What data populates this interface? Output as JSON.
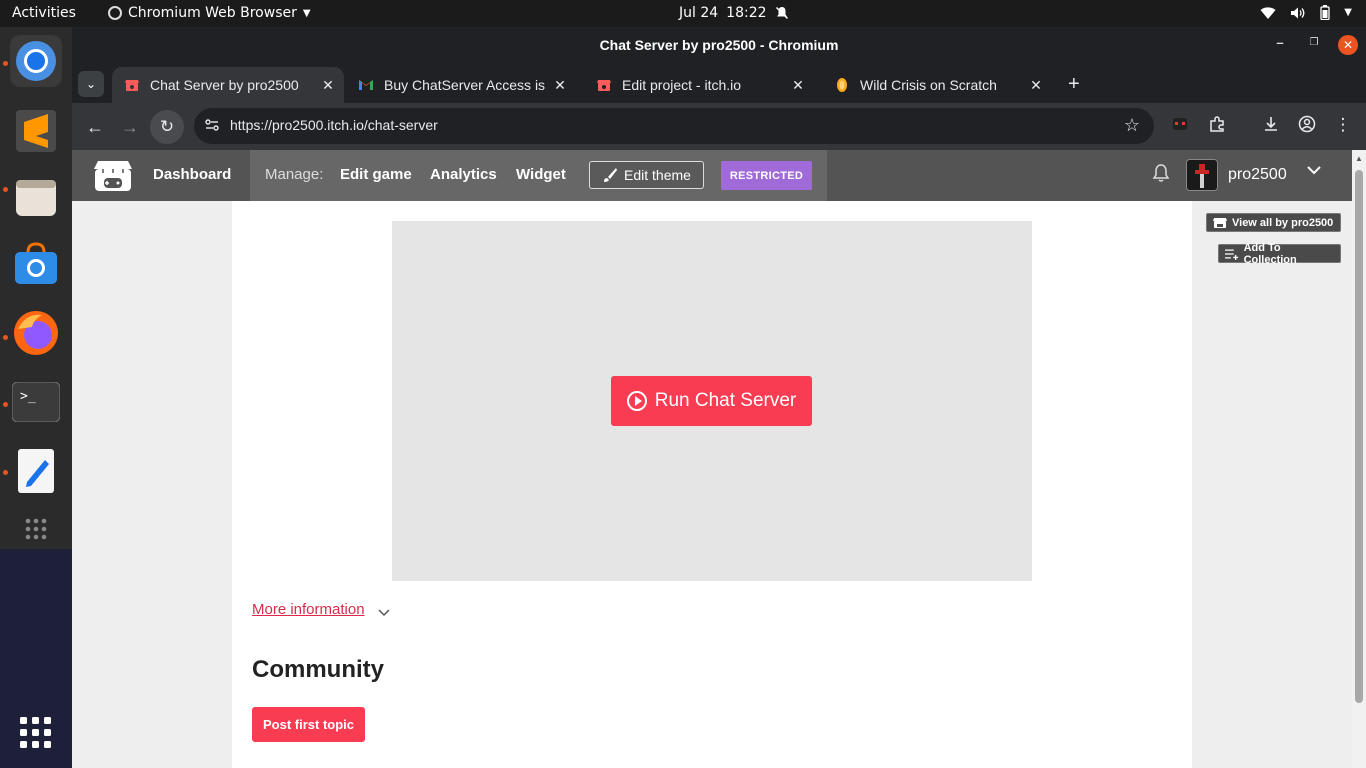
{
  "topbar": {
    "activities": "Activities",
    "app_name": "Chromium Web Browser",
    "date": "Jul 24",
    "time": "18:22"
  },
  "window": {
    "title": "Chat Server by pro2500 - Chromium"
  },
  "tabs": [
    {
      "label": "Chat Server by pro2500",
      "icon": "itchio-icon",
      "active": true
    },
    {
      "label": "Buy ChatServer Access is",
      "icon": "gmail-icon",
      "active": false
    },
    {
      "label": "Edit project - itch.io",
      "icon": "itchio-icon",
      "active": false
    },
    {
      "label": "Wild Crisis on Scratch",
      "icon": "scratch-icon",
      "active": false
    }
  ],
  "toolbar": {
    "url": "https://pro2500.itch.io/chat-server"
  },
  "itch_nav": {
    "dashboard": "Dashboard",
    "manage": "Manage:",
    "edit_game": "Edit game",
    "analytics": "Analytics",
    "widget": "Widget",
    "edit_theme": "Edit theme",
    "restricted": "RESTRICTED",
    "username": "pro2500"
  },
  "sidebar": {
    "view_all": "View all by pro2500",
    "add_collection": "Add To Collection"
  },
  "main": {
    "run_button": "Run Chat Server",
    "more_info": "More information",
    "community_heading": "Community",
    "post_topic": "Post first topic"
  },
  "colors": {
    "itch_red": "#fa3c52",
    "restricted_purple": "#a06ad8",
    "ubuntu_orange": "#e95420"
  }
}
